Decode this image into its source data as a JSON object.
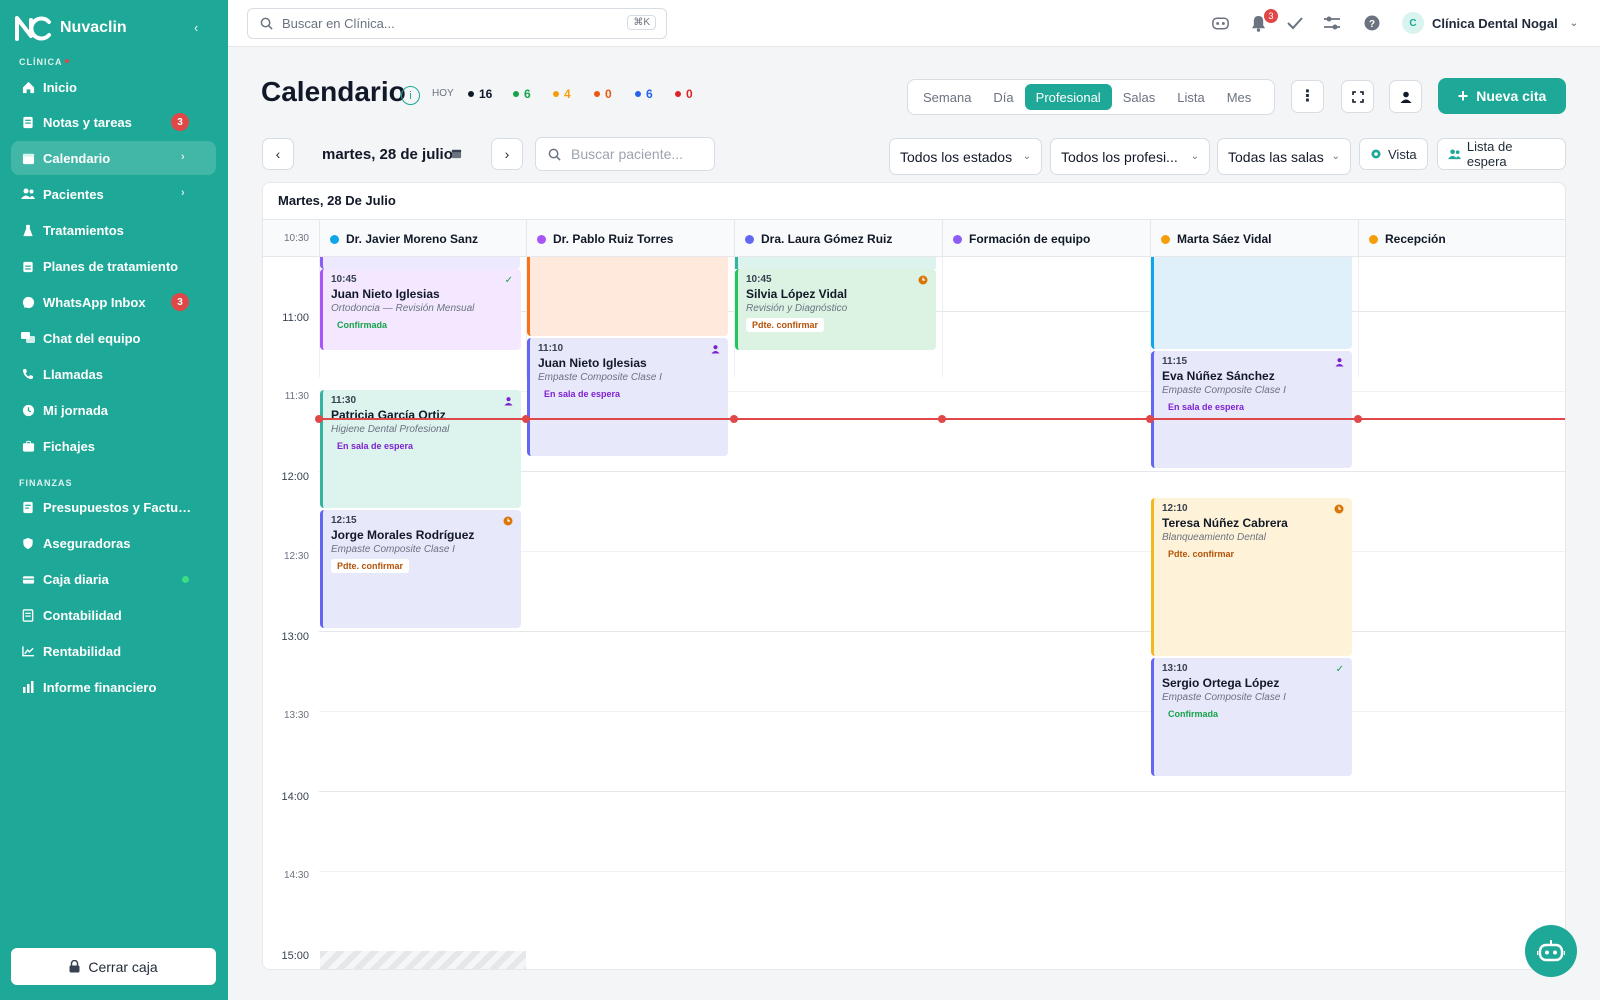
{
  "brand": {
    "name": "Nuvaclin"
  },
  "sidebar": {
    "section_clinica": "CLÍNICA",
    "section_finanzas": "FINANZAS",
    "items": [
      {
        "label": "Inicio"
      },
      {
        "label": "Notas y tareas",
        "badge": "3"
      },
      {
        "label": "Calendario"
      },
      {
        "label": "Pacientes"
      },
      {
        "label": "Tratamientos"
      },
      {
        "label": "Planes de tratamiento"
      },
      {
        "label": "WhatsApp Inbox",
        "badge": "3"
      },
      {
        "label": "Chat del equipo"
      },
      {
        "label": "Llamadas"
      },
      {
        "label": "Mi jornada"
      },
      {
        "label": "Fichajes"
      },
      {
        "label": "Presupuestos y Facturas"
      },
      {
        "label": "Aseguradoras"
      },
      {
        "label": "Caja diaria"
      },
      {
        "label": "Contabilidad"
      },
      {
        "label": "Rentabilidad"
      },
      {
        "label": "Informe financiero"
      }
    ],
    "cerrar_caja": "Cerrar caja"
  },
  "topbar": {
    "search_placeholder": "Buscar en Clínica...",
    "shortcut": "⌘K",
    "notification_count": "3",
    "clinic_initial": "C",
    "clinic_name": "Clínica Dental Nogal"
  },
  "calendar": {
    "title": "Calendario",
    "hoy_label": "HOY",
    "stats": [
      {
        "value": "16",
        "color": "#111827"
      },
      {
        "value": "6",
        "color": "#16a34a"
      },
      {
        "value": "4",
        "color": "#f59e0b"
      },
      {
        "value": "0",
        "color": "#ea580c"
      },
      {
        "value": "6",
        "color": "#2563eb"
      },
      {
        "value": "0",
        "color": "#dc2626"
      }
    ],
    "views": [
      "Semana",
      "Día",
      "Profesional",
      "Salas",
      "Lista",
      "Mes"
    ],
    "active_view": "Profesional",
    "new_button": "Nueva cita",
    "date": "martes, 28 de julio",
    "patient_search_placeholder": "Buscar paciente...",
    "filters": {
      "estados": "Todos los estados",
      "profesionales": "Todos los profesi...",
      "salas": "Todas las salas"
    },
    "vista_button": "Vista",
    "waitlist_button": "Lista de espera",
    "grid_date": "Martes, 28 De Julio",
    "columns": [
      {
        "name": "Dr. Javier Moreno Sanz",
        "color": "#0ea5e9"
      },
      {
        "name": "Dr. Pablo Ruiz Torres",
        "color": "#a855f7"
      },
      {
        "name": "Dra. Laura Gómez Ruiz",
        "color": "#6366f1"
      },
      {
        "name": "Formación de equipo",
        "color": "#8b5cf6"
      },
      {
        "name": "Marta Sáez Vidal",
        "color": "#f59e0b"
      },
      {
        "name": "Recepción",
        "color": "#f59e0b"
      }
    ],
    "times": [
      "10:30",
      "11:00",
      "11:30",
      "12:00",
      "12:30",
      "13:00",
      "13:30",
      "14:00",
      "14:30",
      "15:00"
    ],
    "appointments": [
      {
        "time": "10:45",
        "name": "Juan Nieto Iglesias",
        "procedure": "Ortodoncia — Revisión Mensual",
        "status": "Confirmada",
        "status_icon": "check-icon"
      },
      {
        "time": "11:30",
        "name": "Patricia García Ortiz",
        "procedure": "Higiene Dental Profesional",
        "status": "En sala de espera",
        "status_icon": "person-icon"
      },
      {
        "time": "12:15",
        "name": "Jorge Morales Rodríguez",
        "procedure": "Empaste Composite Clase I",
        "status": "Pdte. confirmar",
        "status_icon": "clock-icon"
      },
      {
        "time": "11:10",
        "name": "Juan Nieto Iglesias",
        "procedure": "Empaste Composite Clase I",
        "status": "En sala de espera",
        "status_icon": "person-icon"
      },
      {
        "time": "10:45",
        "name": "Silvia López Vidal",
        "procedure": "Revisión y Diagnóstico",
        "status": "Pdte. confirmar",
        "status_icon": "clock-icon"
      },
      {
        "time": "11:15",
        "name": "Eva Núñez Sánchez",
        "procedure": "Empaste Composite Clase I",
        "status": "En sala de espera",
        "status_icon": "person-icon"
      },
      {
        "time": "12:10",
        "name": "Teresa Núñez Cabrera",
        "procedure": "Blanqueamiento Dental",
        "status": "Pdte. confirmar",
        "status_icon": "clock-icon"
      },
      {
        "time": "13:10",
        "name": "Sergio Ortega López",
        "procedure": "Empaste Composite Clase I",
        "status": "Confirmada",
        "status_icon": "check-icon"
      }
    ]
  }
}
